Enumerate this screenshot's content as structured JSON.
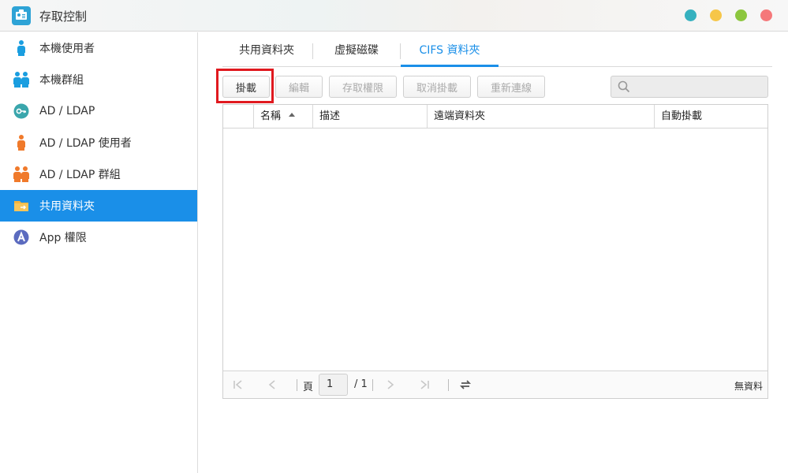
{
  "window": {
    "title": "存取控制",
    "controls": [
      {
        "name": "minimize-button",
        "color": "#36b1bf"
      },
      {
        "name": "help-button",
        "color": "#f6c648"
      },
      {
        "name": "maximize-button",
        "color": "#8cc63e"
      },
      {
        "name": "close-button",
        "color": "#f5787a"
      }
    ]
  },
  "sidebar": {
    "items": [
      {
        "label": "本機使用者",
        "icon": "local-user-icon"
      },
      {
        "label": "本機群組",
        "icon": "local-group-icon"
      },
      {
        "label": "AD / LDAP",
        "icon": "ad-ldap-key-icon"
      },
      {
        "label": "AD / LDAP 使用者",
        "icon": "ad-ldap-user-icon"
      },
      {
        "label": "AD / LDAP 群組",
        "icon": "ad-ldap-group-icon"
      },
      {
        "label": "共用資料夾",
        "icon": "shared-folder-icon",
        "active": true
      },
      {
        "label": "App 權限",
        "icon": "app-permission-icon"
      }
    ]
  },
  "tabs": [
    {
      "label": "共用資料夾"
    },
    {
      "label": "虛擬磁碟"
    },
    {
      "label": "CIFS 資料夾",
      "active": true
    }
  ],
  "toolbar": {
    "mount_label": "掛載",
    "edit_label": "編輯",
    "permission_label": "存取權限",
    "unmount_label": "取消掛載",
    "reconnect_label": "重新連線"
  },
  "search": {
    "placeholder": ""
  },
  "grid": {
    "columns": [
      {
        "label": ""
      },
      {
        "label": "名稱"
      },
      {
        "label": "描述"
      },
      {
        "label": "遠端資料夾"
      },
      {
        "label": "自動掛載"
      }
    ],
    "rows": []
  },
  "pager": {
    "page_label": "頁",
    "current_page": "1",
    "total_pages": "/ 1",
    "status": "無資料"
  },
  "colors": {
    "accent": "#1a8fe8",
    "highlight": "#e0191f",
    "person_blue": "#1a9ee0",
    "person_orange": "#f07a2b"
  }
}
